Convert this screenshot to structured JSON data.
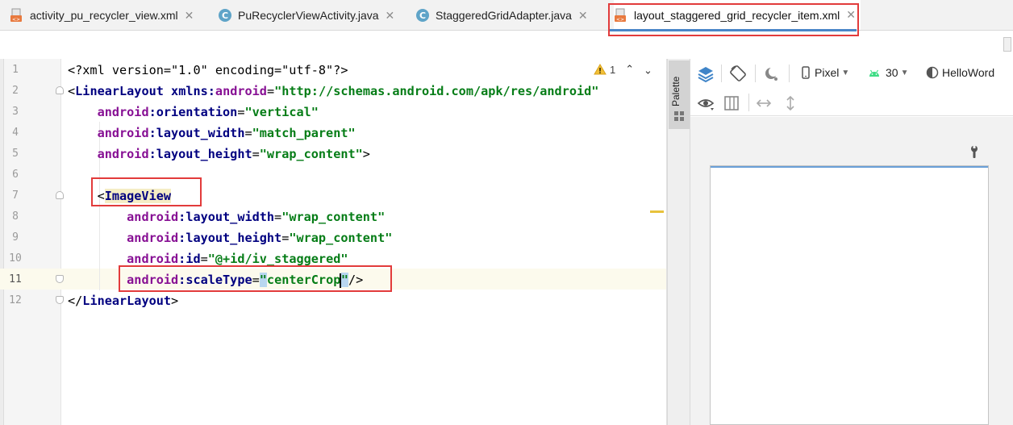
{
  "tabs": [
    {
      "label": "activity_pu_recycler_view.xml",
      "icon": "xml-file-icon",
      "active": false
    },
    {
      "label": "PuRecyclerViewActivity.java",
      "icon": "java-class-icon",
      "icon_letter": "C",
      "active": false
    },
    {
      "label": "StaggeredGridAdapter.java",
      "icon": "java-class-icon",
      "icon_letter": "C",
      "active": false
    },
    {
      "label": "layout_staggered_grid_recycler_item.xml",
      "icon": "xml-file-icon",
      "active": true
    }
  ],
  "tab_close_glyph": "✕",
  "editor": {
    "line_numbers": [
      "1",
      "2",
      "3",
      "4",
      "5",
      "6",
      "7",
      "8",
      "9",
      "10",
      "11",
      "12"
    ],
    "current_line": "11",
    "warning_count": "1",
    "lines": [
      {
        "segments": [
          [
            "pi",
            "<?xml version=\"1.0\" encoding=\"utf-8\"?>"
          ]
        ]
      },
      {
        "segments": [
          [
            "punct",
            "<"
          ],
          [
            "tag",
            "LinearLayout"
          ],
          [
            "punct",
            " "
          ],
          [
            "attr",
            "xmlns:"
          ],
          [
            "ns",
            "android"
          ],
          [
            "punct",
            "="
          ],
          [
            "val",
            "\"http://schemas.android.com/apk/res/android\""
          ]
        ]
      },
      {
        "segments": [
          [
            "punct",
            "    "
          ],
          [
            "ns",
            "android"
          ],
          [
            "attr",
            ":orientation"
          ],
          [
            "punct",
            "="
          ],
          [
            "val",
            "\"vertical\""
          ]
        ]
      },
      {
        "segments": [
          [
            "punct",
            "    "
          ],
          [
            "ns",
            "android"
          ],
          [
            "attr",
            ":layout_width"
          ],
          [
            "punct",
            "="
          ],
          [
            "val",
            "\"match_parent\""
          ]
        ]
      },
      {
        "segments": [
          [
            "punct",
            "    "
          ],
          [
            "ns",
            "android"
          ],
          [
            "attr",
            ":layout_height"
          ],
          [
            "punct",
            "="
          ],
          [
            "val",
            "\"wrap_content\""
          ],
          [
            "punct",
            ">"
          ]
        ]
      },
      {
        "segments": []
      },
      {
        "segments": [
          [
            "punct",
            "    <"
          ],
          [
            "taghl",
            "ImageView"
          ]
        ]
      },
      {
        "segments": [
          [
            "punct",
            "        "
          ],
          [
            "ns",
            "android"
          ],
          [
            "attr",
            ":layout_width"
          ],
          [
            "punct",
            "="
          ],
          [
            "val",
            "\"wrap_content\""
          ]
        ]
      },
      {
        "segments": [
          [
            "punct",
            "        "
          ],
          [
            "ns",
            "android"
          ],
          [
            "attr",
            ":layout_height"
          ],
          [
            "punct",
            "="
          ],
          [
            "val",
            "\"wrap_content\""
          ]
        ]
      },
      {
        "segments": [
          [
            "punct",
            "        "
          ],
          [
            "ns",
            "android"
          ],
          [
            "attr",
            ":id"
          ],
          [
            "punct",
            "="
          ],
          [
            "val",
            "\"@+id/iv_staggered\""
          ]
        ]
      },
      {
        "segments": [
          [
            "punct",
            "        "
          ],
          [
            "ns",
            "android"
          ],
          [
            "attr",
            ":scaleType"
          ],
          [
            "punct",
            "="
          ],
          [
            "quotehl",
            "\""
          ],
          [
            "val",
            "centerCrop"
          ],
          [
            "caret",
            ""
          ],
          [
            "quotehl",
            "\""
          ],
          [
            "punct",
            "/>"
          ]
        ]
      },
      {
        "segments": [
          [
            "punct",
            "</"
          ],
          [
            "tag",
            "LinearLayout"
          ],
          [
            "punct",
            ">"
          ]
        ]
      }
    ]
  },
  "palette": {
    "label": "Palette"
  },
  "preview_toolbar": {
    "device": "Pixel",
    "api_level": "30",
    "theme": "HelloWord"
  },
  "colors": {
    "highlight_box": "#e23b3b",
    "active_tab_underline": "#4a86c8",
    "xml_tag": "#000080",
    "xml_namespace": "#871094",
    "xml_value": "#067d17"
  }
}
